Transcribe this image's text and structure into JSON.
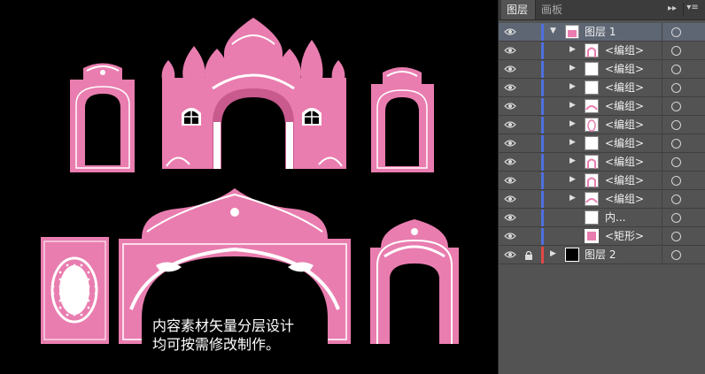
{
  "canvas": {
    "caption_line1": "内容素材矢量分层设计",
    "caption_line2": "均可按需修改制作。",
    "colors": {
      "pink": "#E97DAF",
      "white": "#FFFFFF",
      "background": "#000000"
    }
  },
  "panel": {
    "tabs": [
      {
        "label": "图层"
      },
      {
        "label": "画板"
      }
    ],
    "collapse_icon": "double-chevron-right-icon",
    "menu_icon": "panel-menu-icon",
    "layers": [
      {
        "label": "图层 1",
        "indent": 0,
        "expanded": true,
        "color": "#4f6fe0",
        "thumb": "layer1"
      },
      {
        "label": "<编组>",
        "indent": 1,
        "color": "#4f6fe0",
        "thumb": "arch"
      },
      {
        "label": "<编组>",
        "indent": 1,
        "color": "#4f6fe0",
        "thumb": "blank"
      },
      {
        "label": "<编组>",
        "indent": 1,
        "color": "#4f6fe0",
        "thumb": "blank"
      },
      {
        "label": "<编组>",
        "indent": 1,
        "color": "#4f6fe0",
        "thumb": "swirl"
      },
      {
        "label": "<编组>",
        "indent": 1,
        "color": "#4f6fe0",
        "thumb": "oval"
      },
      {
        "label": "<编组>",
        "indent": 1,
        "color": "#4f6fe0",
        "thumb": "blank"
      },
      {
        "label": "<编组>",
        "indent": 1,
        "color": "#4f6fe0",
        "thumb": "arch"
      },
      {
        "label": "<编组>",
        "indent": 1,
        "color": "#4f6fe0",
        "thumb": "arch"
      },
      {
        "label": "<编组>",
        "indent": 1,
        "color": "#4f6fe0",
        "thumb": "swirl"
      },
      {
        "label": "内...",
        "indent": 1,
        "color": "#4f6fe0",
        "thumb": "blank",
        "no_arrow": true
      },
      {
        "label": "<矩形>",
        "indent": 1,
        "color": "#4f6fe0",
        "thumb": "pinkrect",
        "no_arrow": true
      },
      {
        "label": "图层 2",
        "indent": 0,
        "expanded": false,
        "locked": true,
        "color": "#e04848",
        "thumb": "black"
      }
    ]
  }
}
